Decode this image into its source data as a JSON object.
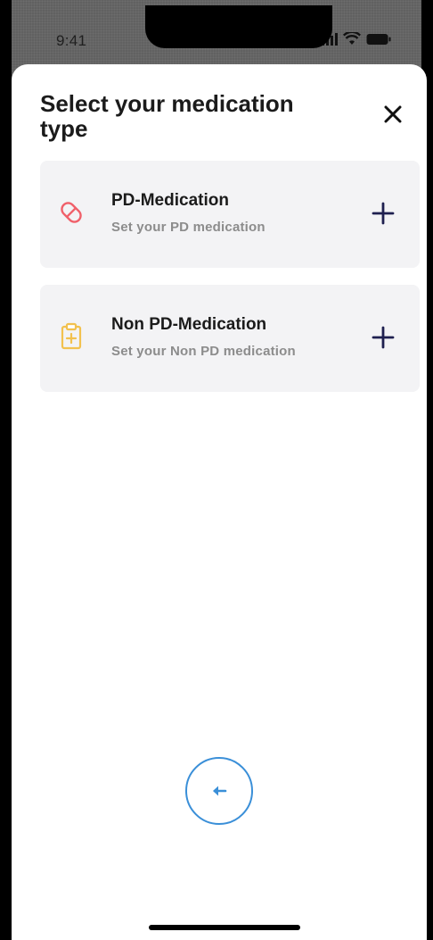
{
  "status_bar": {
    "time": "9:41"
  },
  "sheet": {
    "title": "Select your medication type",
    "close_icon": "close-icon"
  },
  "options": [
    {
      "title": "PD-Medication",
      "subtitle": "Set your PD medication",
      "icon": "pill-icon",
      "icon_color": "#f0606a",
      "action_icon": "plus-icon"
    },
    {
      "title": "Non PD-Medication",
      "subtitle": "Set your Non PD medication",
      "icon": "clipboard-plus-icon",
      "icon_color": "#f2c14e",
      "action_icon": "plus-icon"
    }
  ],
  "footer": {
    "back_icon": "arrow-left-icon",
    "accent_color": "#3a8fd8"
  }
}
